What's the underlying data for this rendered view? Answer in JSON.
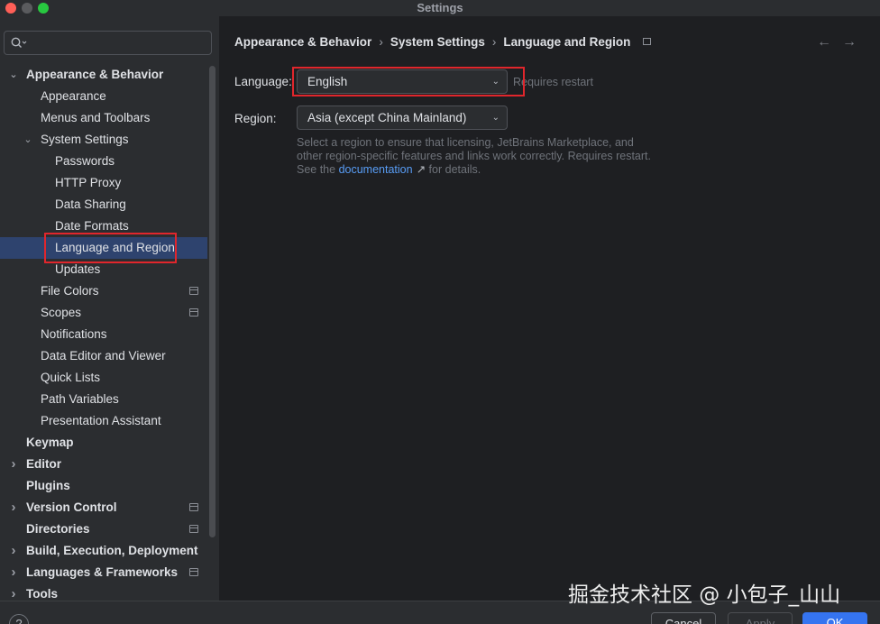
{
  "window": {
    "title": "Settings"
  },
  "search": {
    "placeholder": ""
  },
  "tree": [
    {
      "label": "Appearance & Behavior",
      "level": 0,
      "bold": true,
      "chevron": "down"
    },
    {
      "label": "Appearance",
      "level": 1
    },
    {
      "label": "Menus and Toolbars",
      "level": 1
    },
    {
      "label": "System Settings",
      "level": 1,
      "chevron": "down"
    },
    {
      "label": "Passwords",
      "level": 2
    },
    {
      "label": "HTTP Proxy",
      "level": 2
    },
    {
      "label": "Data Sharing",
      "level": 2
    },
    {
      "label": "Date Formats",
      "level": 2
    },
    {
      "label": "Language and Region",
      "level": 2,
      "selected": true
    },
    {
      "label": "Updates",
      "level": 2
    },
    {
      "label": "File Colors",
      "level": 1,
      "project": true
    },
    {
      "label": "Scopes",
      "level": 1,
      "project": true
    },
    {
      "label": "Notifications",
      "level": 1
    },
    {
      "label": "Data Editor and Viewer",
      "level": 1
    },
    {
      "label": "Quick Lists",
      "level": 1
    },
    {
      "label": "Path Variables",
      "level": 1
    },
    {
      "label": "Presentation Assistant",
      "level": 1
    },
    {
      "label": "Keymap",
      "level": 0,
      "bold": true
    },
    {
      "label": "Editor",
      "level": 0,
      "bold": true,
      "chevron": "right"
    },
    {
      "label": "Plugins",
      "level": 0,
      "bold": true
    },
    {
      "label": "Version Control",
      "level": 0,
      "bold": true,
      "chevron": "right",
      "project": true
    },
    {
      "label": "Directories",
      "level": 0,
      "bold": true,
      "project": true
    },
    {
      "label": "Build, Execution, Deployment",
      "level": 0,
      "bold": true,
      "chevron": "right"
    },
    {
      "label": "Languages & Frameworks",
      "level": 0,
      "bold": true,
      "chevron": "right",
      "project": true
    },
    {
      "label": "Tools",
      "level": 0,
      "bold": true,
      "chevron": "right"
    }
  ],
  "breadcrumb": {
    "item1": "Appearance & Behavior",
    "item2": "System Settings",
    "item3": "Language and Region"
  },
  "language": {
    "label": "Language:",
    "value": "English",
    "hint": "Requires restart"
  },
  "region": {
    "label": "Region:",
    "value": "Asia (except China Mainland)",
    "description_before": "Select a region to ensure that licensing, JetBrains Marketplace, and other region-specific features and links work correctly. Requires restart. See the ",
    "link": "documentation",
    "link_arrow": "↗",
    "description_after": " for details."
  },
  "footer": {
    "help": "?",
    "cancel": "Cancel",
    "apply": "Apply",
    "ok": "OK"
  },
  "watermark": "掘金技术社区 @ 小包子_山山",
  "colors": {
    "selection": "#2e436e",
    "accent": "#3574f0",
    "highlight_box": "#e0262c",
    "link": "#589df6"
  }
}
